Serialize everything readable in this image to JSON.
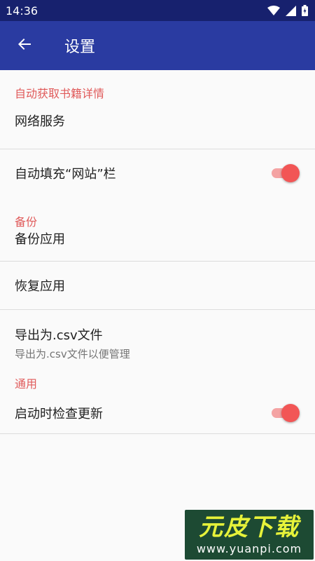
{
  "status_bar": {
    "time": "14:36",
    "icons": [
      "wifi-icon",
      "signal-icon",
      "battery-icon"
    ]
  },
  "app_bar": {
    "back_icon": "arrow-left-icon",
    "title": "设置"
  },
  "sections": {
    "book_details": {
      "header": "自动获取书籍详情",
      "network_service": "网络服务"
    },
    "autofill": {
      "title": "自动填充“网站”栏",
      "enabled": true
    },
    "backup": {
      "header": "备份",
      "backup_app": "备份应用",
      "restore_app": "恢复应用",
      "export_title": "导出为.csv文件",
      "export_subtitle": "导出为.csv文件以便管理"
    },
    "general": {
      "header": "通用",
      "check_updates": "启动时检查更新",
      "check_updates_enabled": true
    }
  },
  "watermark": {
    "logo": "元皮下载",
    "url": "www.yuanpi.com"
  },
  "colors": {
    "status_bar": "#17216e",
    "app_bar": "#2a3ba1",
    "accent": "#f25656",
    "section_header": "#e05a5a"
  }
}
